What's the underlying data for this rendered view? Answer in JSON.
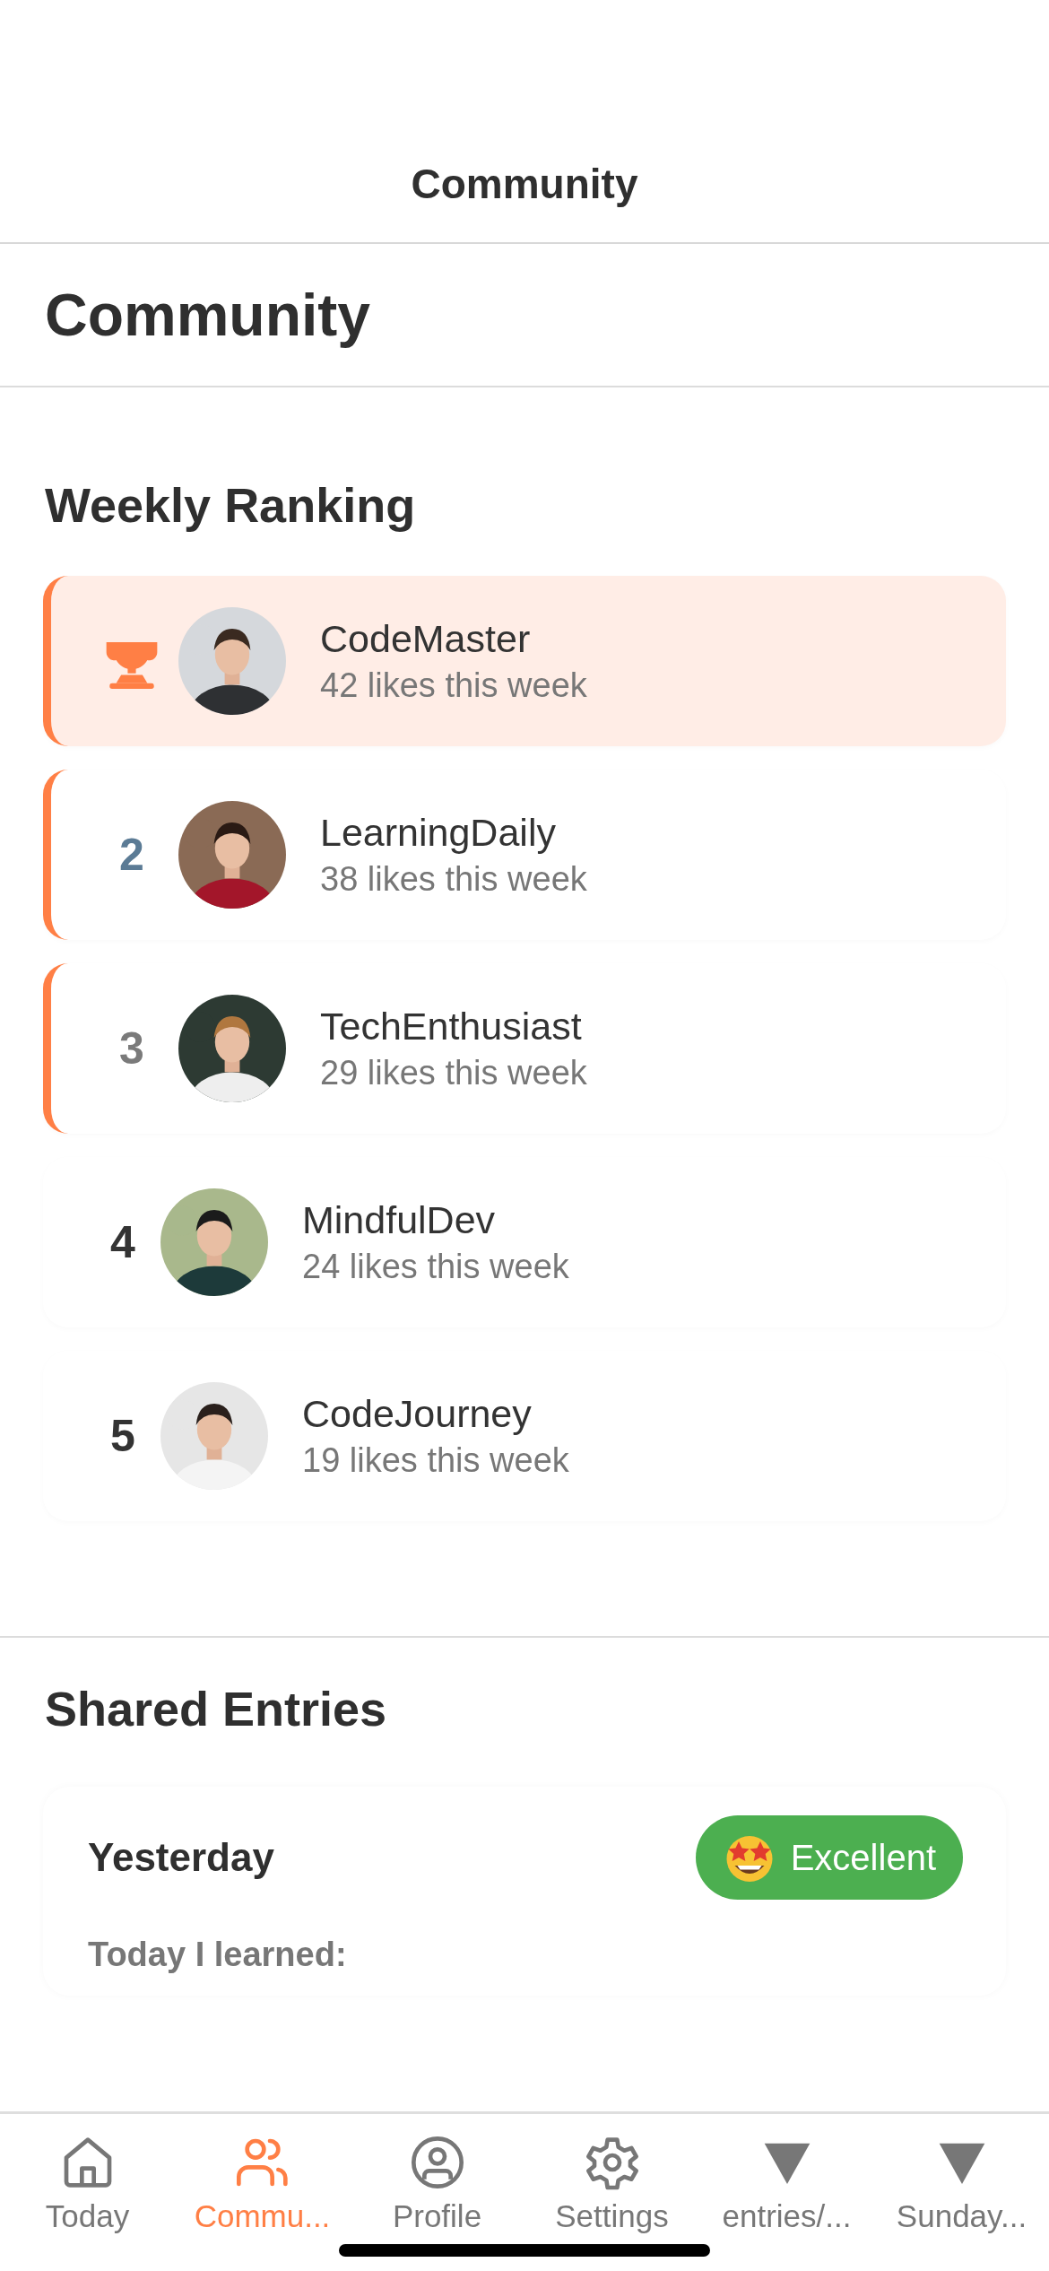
{
  "nav_bar": {
    "title": "Community"
  },
  "header": {
    "title": "Community"
  },
  "weekly_ranking": {
    "title": "Weekly Ranking",
    "rows": [
      {
        "kind": "trophy",
        "name": "CodeMaster",
        "likes": "42 likes this week",
        "highlighted": true,
        "accent": true,
        "color": "#ff7f45"
      },
      {
        "kind": "number",
        "rank": "2",
        "name": "LearningDaily",
        "likes": "38 likes this week",
        "highlighted": false,
        "accent": true,
        "color": "#5b7b95"
      },
      {
        "kind": "number",
        "rank": "3",
        "name": "TechEnthusiast",
        "likes": "29 likes this week",
        "highlighted": false,
        "accent": true,
        "color": "#7a7a7a"
      },
      {
        "kind": "number",
        "rank": "4",
        "name": "MindfulDev",
        "likes": "24 likes this week",
        "highlighted": false,
        "accent": false,
        "color": "#333333"
      },
      {
        "kind": "number",
        "rank": "5",
        "name": "CodeJourney",
        "likes": "19 likes this week",
        "highlighted": false,
        "accent": false,
        "color": "#333333"
      }
    ]
  },
  "shared_entries": {
    "title": "Shared Entries",
    "entries": [
      {
        "date": "Yesterday",
        "mood": "Excellent",
        "prompt": "Today I learned:"
      }
    ]
  },
  "tab_bar": [
    {
      "kind": "home",
      "label": "Today",
      "selected": false
    },
    {
      "kind": "people",
      "label": "Commu...",
      "selected": true
    },
    {
      "kind": "profile",
      "label": "Profile",
      "selected": false
    },
    {
      "kind": "gear",
      "label": "Settings",
      "selected": false
    },
    {
      "kind": "triangle",
      "label": "entries/...",
      "selected": false
    },
    {
      "kind": "triangle",
      "label": "Sunday...",
      "selected": false
    }
  ]
}
